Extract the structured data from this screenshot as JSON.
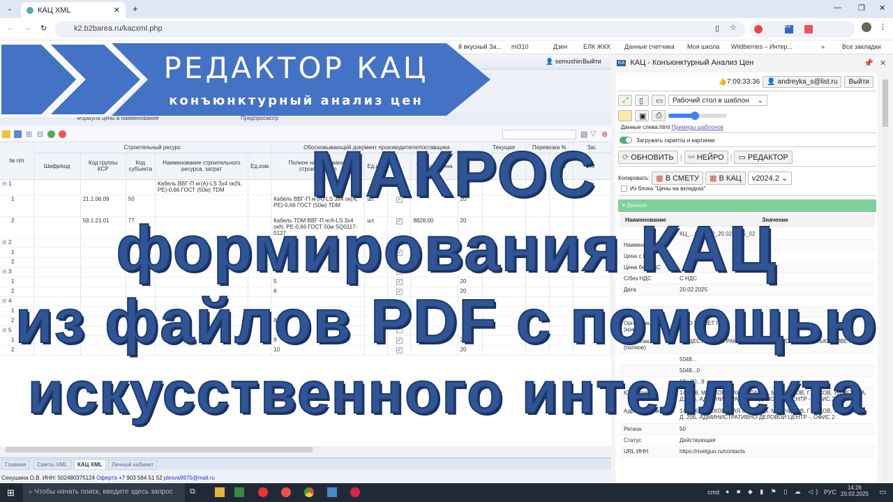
{
  "browser": {
    "tab_title": "КАЦ XML",
    "url": "k2.b2barea.ru/kacxml.php",
    "bookmarks": [
      "й вкусный За...",
      "ml310",
      "Дзен",
      "ЕЛК ЖКХ",
      "Данные счетчика",
      "Моя школа",
      "Wildberries – Интер..."
    ],
    "all_bookmarks": "Все закладки"
  },
  "banner": {
    "title": "РЕДАКТОР КАЦ",
    "subtitle": "конъюнктурный анализ цен"
  },
  "overlay": {
    "line1": "МАКРОС",
    "line2": "формирования КАЦ",
    "line3": "из файлов PDF с помощью",
    "line4": "искусственного интеллекта"
  },
  "app": {
    "user": "semushin",
    "logout": "Выйти",
    "tab1": "Формула цены в наименование",
    "tab2": "Предпросмотр",
    "headers": {
      "num": "№ п/п",
      "group": "Строительный ресурс",
      "doc": "Обосновывающий документ производителя/поставщика",
      "cur": "Текущая",
      "trans": "Перевозка %",
      "zag": "Заг.",
      "code": "Шифр/код",
      "ksr": "Код группы КСР",
      "subj": "Код субъекта",
      "name": "Наименование строительного ресурса, затрат",
      "unit": "Ед.изм.",
      "full": "Полное наименование строительного",
      "unit2": "Ед.изм.",
      "price": "Текущая цена",
      "pct": "%",
      "rub": "руб"
    },
    "rows": [
      {
        "n": "1",
        "level": 0,
        "name": "Кабель ВВГ-П нг(А)-LS 3х4 ок(N, PE)-0,66 ГОСТ (50м) TDM",
        "full": "",
        "unit": "",
        "checked": false,
        "price": "",
        "vat": ""
      },
      {
        "n": "1",
        "level": 1,
        "ksr": "21.1.06.09",
        "subj": "50",
        "full": "Кабель ВВГ-П нг(А)-LS 3х4 ок(N, PE)-0,66 ГОСТ (50м) TDM",
        "unit": "шт.",
        "checked": true,
        "price": "",
        "vat": "20"
      },
      {
        "n": "2",
        "level": 1,
        "ksr": "59.1.21.01",
        "subj": "77",
        "full": "Кабель TDM ВВГ-П нгА-LS 3х4 окN, PE-0,66 ГОСТ 50м SQ0117-0127",
        "unit": "шт.",
        "checked": true,
        "price": "8828,00",
        "vat": "20"
      },
      {
        "n": "2",
        "level": 0,
        "checked": false
      },
      {
        "n": "1",
        "level": 1,
        "checked": true
      },
      {
        "n": "2",
        "level": 1
      },
      {
        "n": "3",
        "level": 0,
        "name": "5",
        "checked": false
      },
      {
        "n": "1",
        "level": 1,
        "full": "5",
        "checked": true,
        "vat": "20"
      },
      {
        "n": "2",
        "level": 1,
        "full": "6",
        "checked": true,
        "vat": "20"
      },
      {
        "n": "4",
        "level": 0
      },
      {
        "n": "1",
        "level": 1
      },
      {
        "n": "2",
        "level": 1,
        "full": "8"
      },
      {
        "n": "5",
        "level": 0,
        "checked": false
      },
      {
        "n": "1",
        "level": 1,
        "full": "9",
        "checked": true,
        "vat": "20"
      },
      {
        "n": "2",
        "level": 1,
        "full": "10",
        "checked": true,
        "vat": "20"
      }
    ],
    "bottom_tabs": [
      "Главная",
      "Сметы XML",
      "КАЦ XML",
      "Личный кабинет"
    ],
    "footer": {
      "text": "Сенушина О.В. ИНН: 502480375124",
      "offer": "Оферта",
      "phone": "+7 903 584 51 52",
      "email": "plesva9975@mail.ru"
    }
  },
  "panel": {
    "title": "КАЦ - Конъюнктурный Анализ Цен",
    "timer": "7:09:33:36",
    "email": "andreyka_s@list.ru",
    "logout": "Выйти",
    "template_select": "Рабочий стол в шаблон",
    "slider_value": 0.45,
    "data_file": "Данные слева.html",
    "examples_link": "Примеры шаблонов",
    "toggle_label": "Загружать скрипты и картинки",
    "refresh": "ОБНОВИТЬ",
    "neuro": "НЕЙРО",
    "editor": "РЕДАКТОР",
    "copy_label": "Копировать:",
    "to_estimate": "В СМЕТУ",
    "to_kac": "В КАЦ",
    "version": "v2024.2",
    "from_block": "Из блока \"Цены на вкладках\"",
    "section": "Данные",
    "col_name": "Наименование",
    "col_value": "Значение",
    "fields": [
      {
        "k": "",
        "v": "КЦ_...0480...2_20.02.2025_02"
      },
      {
        "k": "Наименование",
        "v": ""
      },
      {
        "k": "Цена с НДС",
        "v": ""
      },
      {
        "k": "Цена без НДС",
        "v": ""
      },
      {
        "k": "С/без НДС",
        "v": "С НДС"
      },
      {
        "k": "Дата",
        "v": "20.02.2025"
      },
      {
        "k": "",
        "v": ""
      },
      {
        "k": "",
        "v": ""
      },
      {
        "k": "Организация (кратко)",
        "v": "ООО \"РИВЕТ ГАН\""
      },
      {
        "k": "Организация (полное)",
        "v": "ОБЩЕСТВО С ОГРАНИЧЕННОЙ ОТВЕТСТВЕННОСТЬЮ \"РИВЕТ ГАН\""
      },
      {
        "k": "",
        "v": "5048..."
      },
      {
        "k": "",
        "v": "5048...0"
      },
      {
        "k": "",
        "v": "12...00...9"
      },
      {
        "k": "Юр. адрес",
        "v": "142306, МОСКОВСКАЯ ОБЛАСТЬ, М.О. ЧЕХОВ, Г ЧЕХОВ, УЛ ЧЕХОВА, Д. 20Б, АДМИНИСТРАТИВНО-ДЕЛОВОЙ ЦЕНТР -, ОФИС 2"
      },
      {
        "k": "Адрес отгрузки",
        "v": "142306, МОСКОВСКАЯ ОБЛАСТЬ, М.О. ЧЕХОВ, Г ЧЕХОВ, УЛ ЧЕХОВА, Д. 20Б, АДМИНИСТРАТИВНО-ДЕЛОВОЙ ЦЕНТР -, ОФИС 2"
      },
      {
        "k": "Регион",
        "v": "50"
      },
      {
        "k": "Статус",
        "v": "Действующая"
      },
      {
        "k": "URL ИНН",
        "v": "https://rivetgun.ru/contacts"
      }
    ]
  },
  "taskbar": {
    "search": "Чтобы начать поиск, введите здесь запрос",
    "cmd": "cmd",
    "lang": "РУС",
    "time": "14:26",
    "date": "20.02.2025"
  },
  "colors": {
    "accent": "#4472c4",
    "overlay_text": "#2f5597",
    "green": "#7fd09a"
  }
}
